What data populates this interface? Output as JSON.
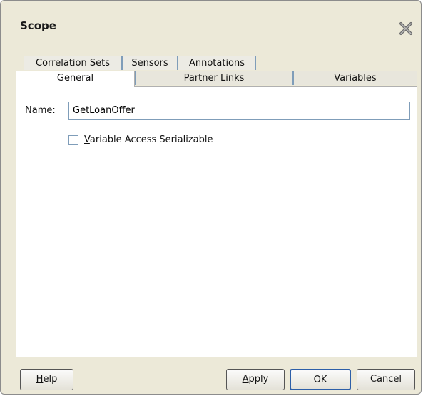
{
  "dialog": {
    "title": "Scope"
  },
  "tabs": {
    "row_back": [
      {
        "label": "Correlation Sets"
      },
      {
        "label": "Sensors"
      },
      {
        "label": "Annotations"
      }
    ],
    "row_front": [
      {
        "label": "General",
        "active": true
      },
      {
        "label": "Partner Links",
        "active": false
      },
      {
        "label": "Variables",
        "active": false
      }
    ]
  },
  "general": {
    "name_label_mnemonic": "N",
    "name_label_rest": "ame:",
    "name_value": "GetLoanOffer",
    "checkbox_label_mnemonic": "V",
    "checkbox_label_rest": "ariable Access Serializable",
    "checkbox_checked": false
  },
  "buttons": {
    "help_mnemonic": "H",
    "help_rest": "elp",
    "apply_mnemonic": "A",
    "apply_rest": "pply",
    "ok": "OK",
    "cancel": "Cancel"
  },
  "icons": {
    "close": "close-icon"
  },
  "colors": {
    "dialog_bg": "#ece9d8",
    "panel_bg": "#ffffff",
    "default_button_border": "#2d5fa8",
    "input_border": "#7f9db9"
  }
}
